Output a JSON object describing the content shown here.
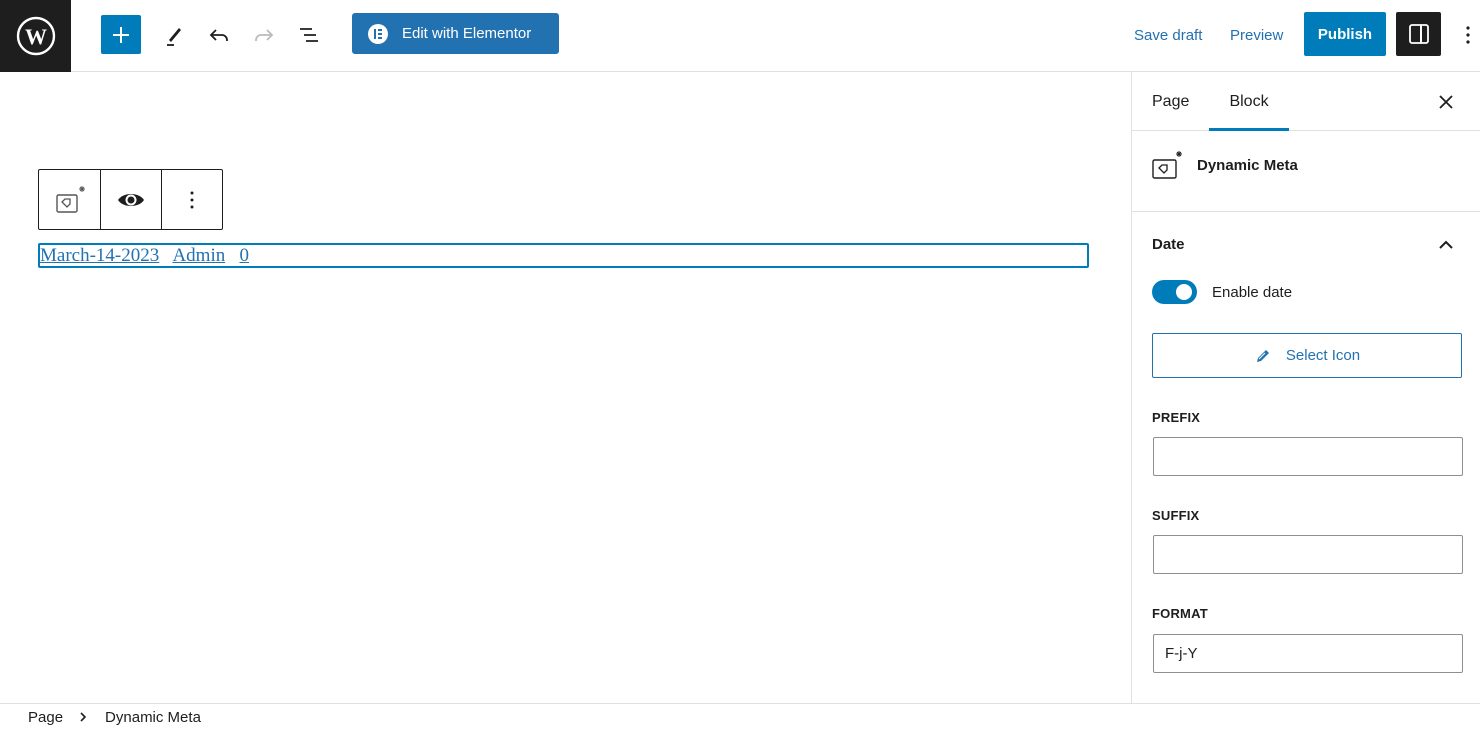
{
  "topbar": {
    "logo": "wordpress-logo",
    "add_block_label": "Add block",
    "tools_label": "Tools",
    "undo_label": "Undo",
    "redo_label": "Redo",
    "list_view_label": "Document overview",
    "elementor_button": "Edit with Elementor",
    "save_draft": "Save draft",
    "preview": "Preview",
    "publish": "Publish",
    "colors": {
      "primary": "#007cba",
      "elementor": "#2271b1",
      "dark": "#1e1e1e"
    }
  },
  "canvas": {
    "block_toolbar": {
      "items": [
        "Dynamic Meta block type",
        "Toggle visibility",
        "Options"
      ]
    },
    "meta_block": {
      "date": "March-14-2023",
      "author": "Admin",
      "comments": "0"
    }
  },
  "sidebar": {
    "tabs": [
      {
        "label": "Page",
        "active": false
      },
      {
        "label": "Block",
        "active": true
      }
    ],
    "block_card": {
      "title": "Dynamic Meta"
    },
    "panel": {
      "title": "Date",
      "expanded": true,
      "enable_date": {
        "label": "Enable date",
        "checked": true
      },
      "select_icon_label": "Select Icon",
      "prefix": {
        "label": "PREFIX",
        "value": ""
      },
      "suffix": {
        "label": "SUFFIX",
        "value": ""
      },
      "format": {
        "label": "FORMAT",
        "value": "F-j-Y"
      }
    }
  },
  "footer": {
    "breadcrumbs": [
      "Page",
      "Dynamic Meta"
    ]
  }
}
